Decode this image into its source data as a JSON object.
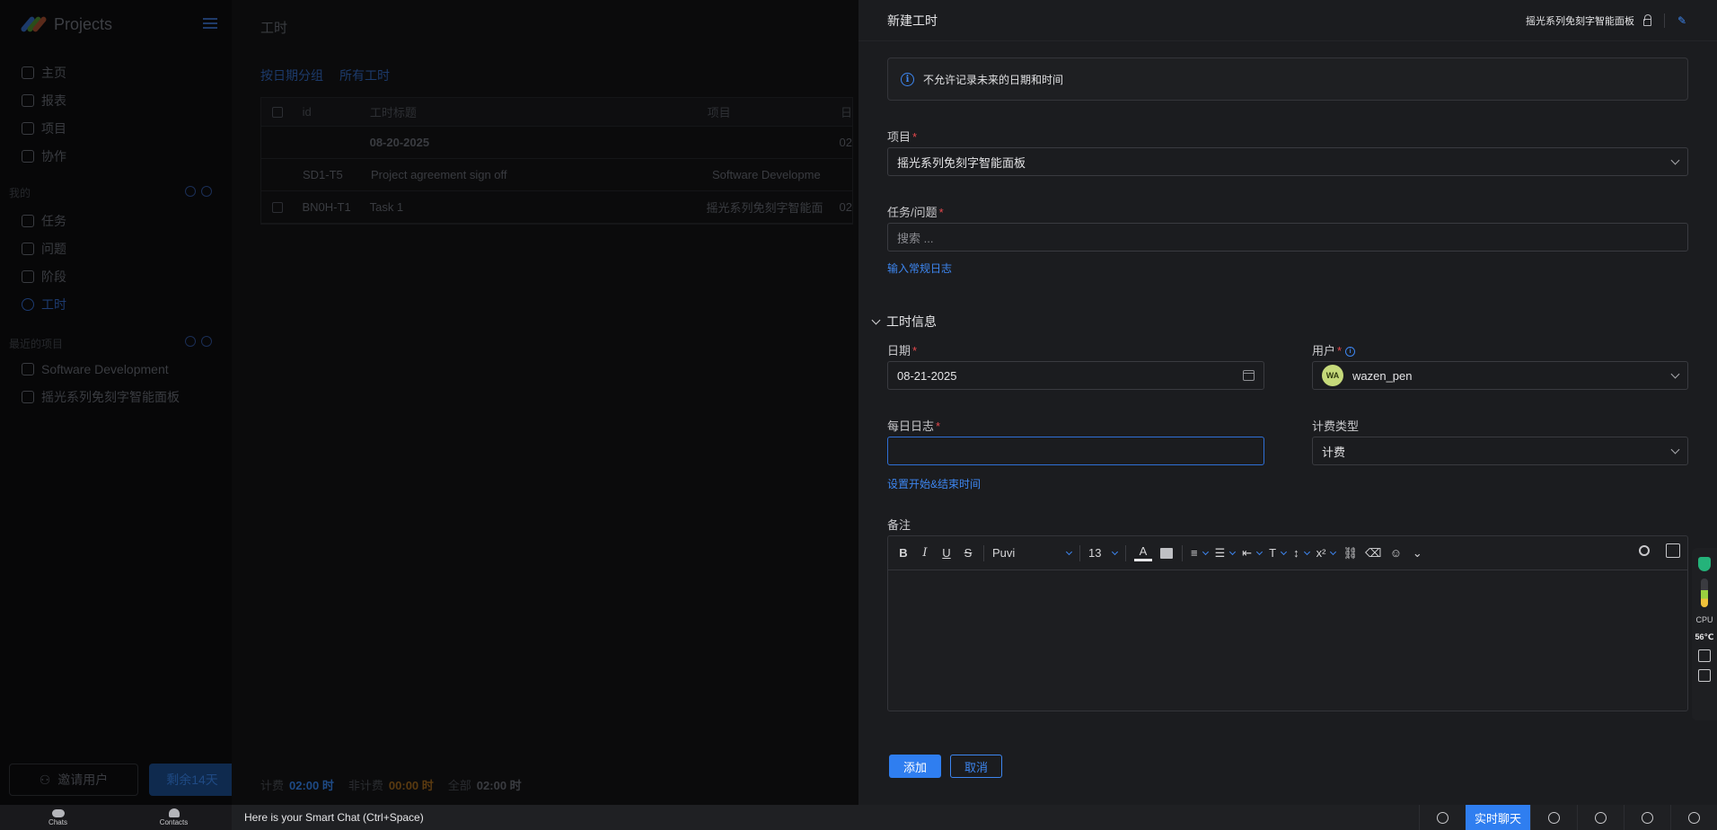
{
  "sidebar": {
    "app_name": "Projects",
    "nav": [
      {
        "label": "主页"
      },
      {
        "label": "报表"
      },
      {
        "label": "项目"
      },
      {
        "label": "协作"
      }
    ],
    "section1_label": "我的",
    "section1_items": [
      {
        "label": "任务"
      },
      {
        "label": "问题"
      },
      {
        "label": "阶段"
      },
      {
        "label": "工时"
      }
    ],
    "section2_label": "最近的项目",
    "section2_items": [
      {
        "label": "Software Development"
      },
      {
        "label": "摇光系列免刻字智能面板"
      }
    ],
    "invite_label": "邀请用户",
    "trial_label": "剩余14天"
  },
  "main": {
    "title": "工时",
    "filter_group": "按日期分组",
    "filter_all": "所有工时",
    "columns": [
      "id",
      "工时标题",
      "项目",
      "日"
    ],
    "group_date": "08-20-2025",
    "group_col": "02",
    "rows": [
      {
        "id": "SD1-T5",
        "title": "Project agreement sign off",
        "project": "Software Developme",
        "day": ""
      },
      {
        "id": "BN0H-T1",
        "title": "Task 1",
        "project": "摇光系列免刻字智能面",
        "day": "02"
      }
    ],
    "totals": {
      "billable_label": "计费",
      "billable_value": "02:00 时",
      "nonbillable_label": "非计费",
      "nonbillable_value": "00:00 时",
      "all_label": "全部",
      "all_value": "02:00 时"
    }
  },
  "drawer": {
    "title": "新建工时",
    "header_project": "摇光系列免刻字智能面板",
    "info_message": "不允许记录未来的日期和时间",
    "project_label": "项目",
    "project_value": "摇光系列免刻字智能面板",
    "task_label": "任务/问题",
    "task_placeholder": "搜索 ...",
    "general_log_link": "输入常规日志",
    "section_title": "工时信息",
    "date_label": "日期",
    "date_value": "08-21-2025",
    "user_label": "用户",
    "user_initials": "WA",
    "user_value": "wazen_pen",
    "daily_log_label": "每日日志",
    "billing_label": "计费类型",
    "billing_value": "计费",
    "set_time_link": "设置开始&结束时间",
    "notes_label": "备注",
    "editor": {
      "bold": "B",
      "italic": "I",
      "underline": "U",
      "strike": "S",
      "font": "Puvi",
      "size": "13",
      "color_a": "A",
      "superscript": "x²"
    },
    "add_label": "添加",
    "cancel_label": "取消"
  },
  "widget": {
    "cpu_label": "CPU",
    "cpu_temp": "56℃"
  },
  "bottombar": {
    "chats": "Chats",
    "contacts": "Contacts",
    "smart_chat": "Here is your Smart Chat (Ctrl+Space)",
    "live_chat": "实时聊天"
  },
  "colors": {
    "accent": "#2f7ef0",
    "required": "#e5484d",
    "drawer_bg": "#1b1c1f"
  }
}
